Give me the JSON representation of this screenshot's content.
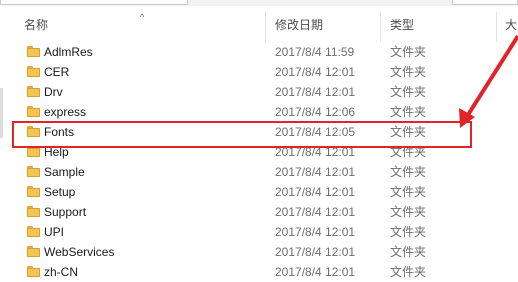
{
  "columns": {
    "name": "名称",
    "date": "修改日期",
    "type": "类型",
    "size": "大"
  },
  "sort_indicator": "^",
  "accent_color": "#e0242a",
  "folder_icon": "folder-icon",
  "rows": [
    {
      "name": "AdlmRes",
      "date": "2017/8/4 11:59",
      "type": "文件夹"
    },
    {
      "name": "CER",
      "date": "2017/8/4 12:01",
      "type": "文件夹"
    },
    {
      "name": "Drv",
      "date": "2017/8/4 12:01",
      "type": "文件夹"
    },
    {
      "name": "express",
      "date": "2017/8/4 12:06",
      "type": "文件夹"
    },
    {
      "name": "Fonts",
      "date": "2017/8/4 12:05",
      "type": "文件夹"
    },
    {
      "name": "Help",
      "date": "2017/8/4 12:01",
      "type": "文件夹"
    },
    {
      "name": "Sample",
      "date": "2017/8/4 12:01",
      "type": "文件夹"
    },
    {
      "name": "Setup",
      "date": "2017/8/4 12:01",
      "type": "文件夹"
    },
    {
      "name": "Support",
      "date": "2017/8/4 12:01",
      "type": "文件夹"
    },
    {
      "name": "UPI",
      "date": "2017/8/4 12:01",
      "type": "文件夹"
    },
    {
      "name": "WebServices",
      "date": "2017/8/4 12:01",
      "type": "文件夹"
    },
    {
      "name": "zh-CN",
      "date": "2017/8/4 12:01",
      "type": "文件夹"
    }
  ]
}
